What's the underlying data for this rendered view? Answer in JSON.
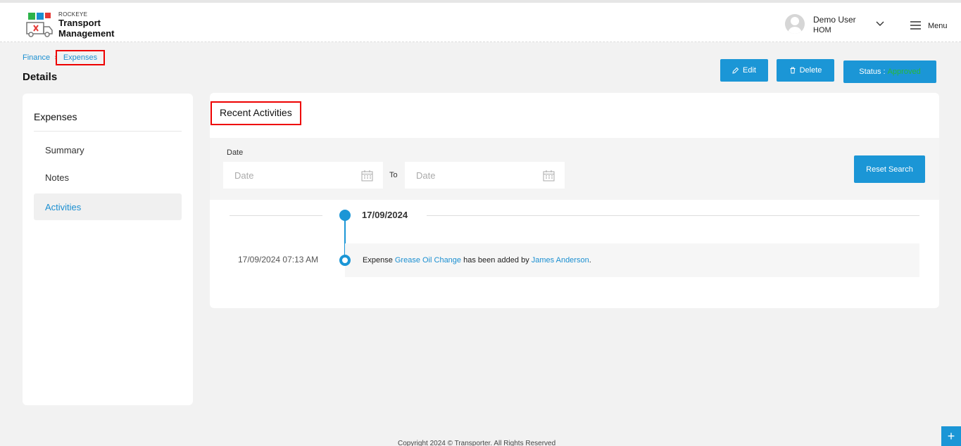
{
  "header": {
    "brand_sub": "ROCKEYE",
    "brand_title": "Transport Management",
    "user_name": "Demo User",
    "user_role": "HOM",
    "menu_label": "Menu"
  },
  "breadcrumb": {
    "parent": "Finance",
    "current": "Expenses"
  },
  "page_title": "Details",
  "actions": {
    "edit_label": "Edit",
    "delete_label": "Delete",
    "status_label": "Status :",
    "status_value": "Approved",
    "status_color": "#28b83a"
  },
  "sidebar": {
    "heading": "Expenses",
    "items": [
      {
        "label": "Summary",
        "active": false
      },
      {
        "label": "Notes",
        "active": false
      },
      {
        "label": "Activities",
        "active": true
      }
    ]
  },
  "activities": {
    "title": "Recent Activities",
    "filter": {
      "date_label": "Date",
      "from_placeholder": "Date",
      "to_label": "To",
      "to_placeholder": "Date",
      "reset_label": "Reset Search"
    },
    "groups": [
      {
        "date": "17/09/2024",
        "entries": [
          {
            "time": "17/09/2024 07:13 AM",
            "prefix": "Expense",
            "item": "Grease Oil Change",
            "middle": "has been added by",
            "user": "James Anderson",
            "suffix": "."
          }
        ]
      }
    ]
  },
  "footer": {
    "copyright": "Copyright 2024 © Transporter. All Rights Reserved"
  },
  "fab_label": "+",
  "colors": {
    "accent": "#1b96d6",
    "link": "#1b8fd1",
    "highlight_border": "#ee0000"
  }
}
